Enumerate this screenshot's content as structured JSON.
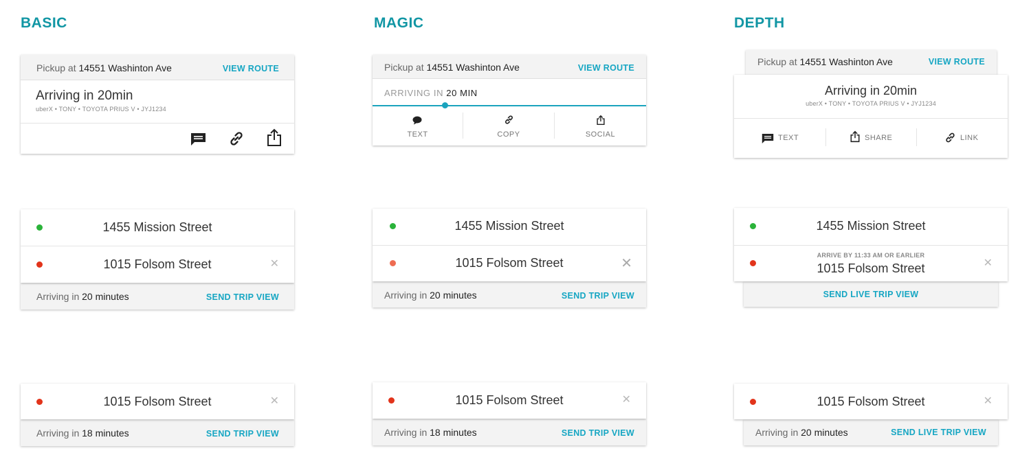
{
  "columns": {
    "basic": "BASIC",
    "magic": "MAGIC",
    "depth": "DEPTH"
  },
  "pickup": {
    "prefix": "Pickup at",
    "address": "14551 Washinton Ave",
    "view_route": "VIEW ROUTE"
  },
  "basic": {
    "arriving_title": "Arriving in 20min",
    "trip_details": "uberX • TONY • TOYOTA PRIUS V • JYJ1234"
  },
  "magic": {
    "arriving_prefix": "ARRIVING IN",
    "arriving_time": "20 MIN",
    "actions": [
      "TEXT",
      "COPY",
      "SOCIAL"
    ]
  },
  "depth": {
    "arriving_title": "Arriving in 20min",
    "trip_details": "uberX • TONY • TOYOTA PRIUS V • JYJ1234",
    "actions": [
      "TEXT",
      "SHARE",
      "LINK"
    ],
    "arrive_by": "ARRIVE BY 11:33 AM OR EARLIER"
  },
  "trip": {
    "origin": "1455 Mission Street",
    "destination": "1015 Folsom Street",
    "arriving_prefix": "Arriving in",
    "arriving_20": "20 minutes",
    "arriving_18": "18 minutes",
    "send_trip_view": "SEND TRIP VIEW",
    "send_live_trip_view": "SEND LIVE TRIP VIEW",
    "close": "✕"
  },
  "colors": {
    "accent": "#16a6c3",
    "title": "#1196a4",
    "origin_dot": "#2bb33a",
    "destination_dot": "#e2341b"
  }
}
